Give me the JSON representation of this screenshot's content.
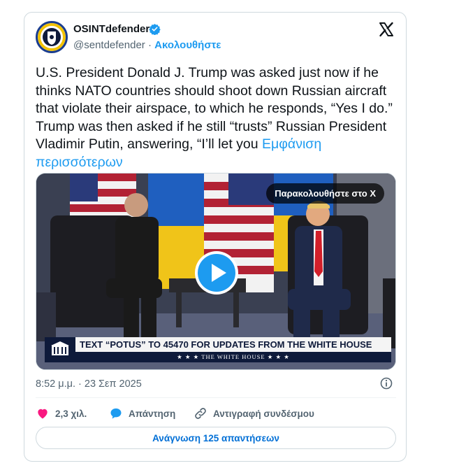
{
  "author": {
    "display_name": "OSINTdefender",
    "handle": "@sentdefender",
    "separator": "·",
    "follow_label": "Ακολουθήστε",
    "verified": true
  },
  "tweet": {
    "text": "U.S. President Donald J. Trump was asked just now if he thinks NATO countries should shoot down Russian aircraft that violate their airspace, to which he responds, “Yes I do.” Trump was then asked if he still “trusts” Russian President Vladimir Putin, answering, “I’ll let you ",
    "show_more": "Εμφάνιση περισσότερων"
  },
  "media": {
    "watch_on_x_label": "Παρακολουθήστε στο X",
    "chyron_main": "TEXT “POTUS” TO 45470 FOR UPDATES FROM THE WHITE HOUSE",
    "chyron_sub": "★ ★ ★   THE WHITE HOUSE   ★ ★ ★"
  },
  "timestamp": "8:52 μ.μ. · 23 Σεπ 2025",
  "actions": {
    "likes_count": "2,3 χιλ.",
    "reply_label": "Απάντηση",
    "copy_link_label": "Αντιγραφή συνδέσμου"
  },
  "read_replies_label": "Ανάγνωση 125 απαντήσεων",
  "colors": {
    "accent": "#1d9bf0",
    "like": "#f91880",
    "text": "#0f1419",
    "muted": "#536471"
  },
  "icons": [
    "avatar",
    "verified-badge-icon",
    "x-logo-icon",
    "play-icon",
    "info-icon",
    "heart-icon",
    "reply-bubble-icon",
    "link-icon"
  ]
}
